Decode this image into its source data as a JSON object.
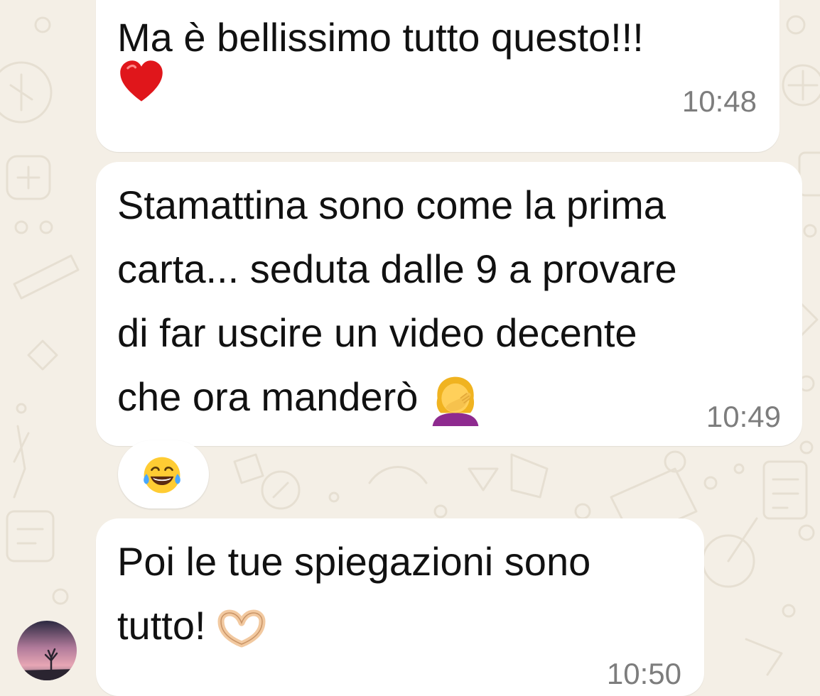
{
  "messages": [
    {
      "lines": [
        "Ma è bellissimo tutto questo!!!"
      ],
      "emoji": "red-heart",
      "time": "10:48"
    },
    {
      "lines": [
        "Stamattina sono come la prima",
        "carta... seduta dalle 9 a provare",
        "di far uscire un video decente",
        "che ora manderò"
      ],
      "emoji": "woman-facepalming",
      "time": "10:49"
    },
    {
      "lines": [
        "Poi le tue spiegazioni sono",
        "tutto!"
      ],
      "emoji": "heart-hands",
      "time": "10:50"
    }
  ],
  "reaction": {
    "emoji": "face-with-tears-of-joy"
  },
  "colors": {
    "background": "#f4efe6",
    "bubble": "#ffffff",
    "timestamp": "#7d7d7d",
    "text": "#111111"
  }
}
